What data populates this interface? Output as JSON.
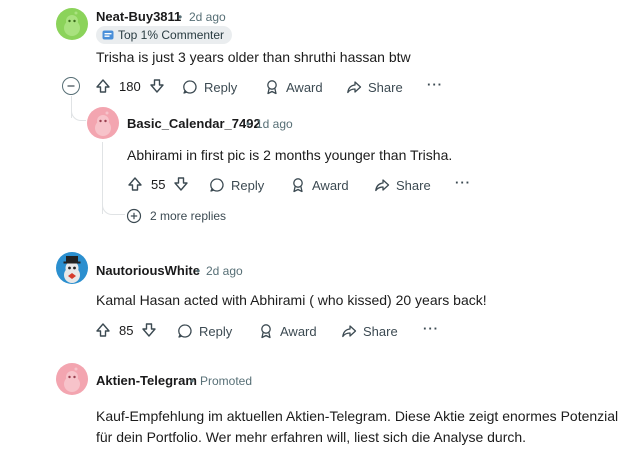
{
  "comments": [
    {
      "username": "Neat-Buy3811",
      "age": "2d ago",
      "badge": "Top 1% Commenter",
      "text": "Trisha is just 3 years older than shruthi hassan btw",
      "votes": "180"
    },
    {
      "username": "Basic_Calendar_7492",
      "age": "1d ago",
      "text": "Abhirami in first pic is 2 months younger than Trisha.",
      "votes": "55"
    },
    {
      "username": "NautoriousWhite",
      "age": "2d ago",
      "text": "Kamal Hasan acted with Abhirami ( who kissed) 20 years back!",
      "votes": "85"
    }
  ],
  "more_replies": "2 more replies",
  "promoted": {
    "username": "Aktien-Telegram",
    "label": "Promoted",
    "lines": [
      "Kauf-Empfehlung im aktuellen Aktien-Telegram. Diese Aktie zeigt enormes Potenzial",
      "für dein Portfolio. Wer mehr erfahren will, liest sich die Analyse durch."
    ]
  },
  "actions": {
    "reply": "Reply",
    "award": "Award",
    "share": "Share",
    "more": "···"
  },
  "colors": {
    "avatar_green": "#8bd35a",
    "avatar_pink": "#f3a5b0",
    "avatar_blue": "#2b8fcf"
  }
}
